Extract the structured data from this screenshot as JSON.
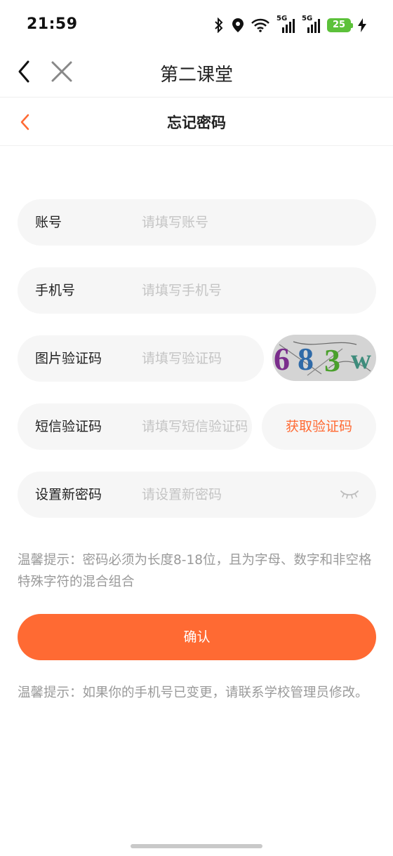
{
  "status_bar": {
    "time": "21:59",
    "network_label_1": "5G",
    "network_label_2": "5G",
    "battery": "25"
  },
  "app_nav": {
    "title": "第二课堂"
  },
  "page_header": {
    "title": "忘记密码"
  },
  "form": {
    "account": {
      "label": "账号",
      "placeholder": "请填写账号"
    },
    "phone": {
      "label": "手机号",
      "placeholder": "请填写手机号"
    },
    "image_code": {
      "label": "图片验证码",
      "placeholder": "请填写验证码",
      "captcha_text": "683w"
    },
    "sms_code": {
      "label": "短信验证码",
      "placeholder": "请填写短信验证码",
      "button": "获取验证码"
    },
    "new_password": {
      "label": "设置新密码",
      "placeholder": "请设置新密码"
    }
  },
  "tips": {
    "password_rule": "温馨提示：密码必须为长度8-18位，且为字母、数字和非空格特殊字符的混合组合",
    "phone_changed": "温馨提示：如果你的手机号已变更，请联系学校管理员修改。"
  },
  "confirm_button": "确认",
  "colors": {
    "accent": "#ff6a33",
    "field_bg": "#f6f6f6",
    "tip_text": "#9a9a9a"
  }
}
